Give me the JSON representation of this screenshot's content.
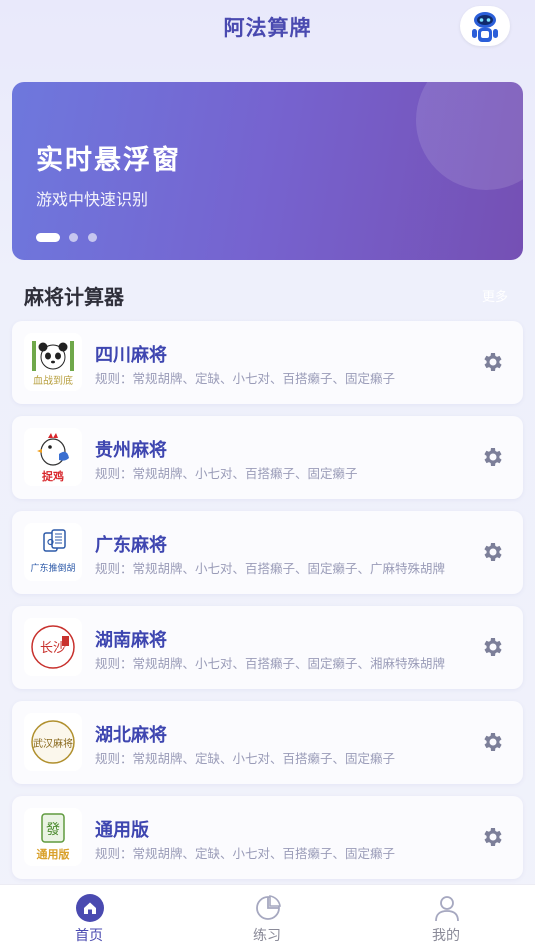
{
  "header": {
    "title": "阿法算牌",
    "avatar_icon": "robot-avatar-icon"
  },
  "banner": {
    "title": "实时悬浮窗",
    "subtitle": "游戏中快速识别",
    "active_slide": 1,
    "slide_count": 3
  },
  "section": {
    "title": "麻将计算器",
    "more_label": "更多"
  },
  "calculators": [
    {
      "name": "四川麻将",
      "rules": "规则：常规胡牌、定缺、小七对、百搭癞子、固定癞子",
      "icon": "panda-icon",
      "icon_text": "血战到底"
    },
    {
      "name": "贵州麻将",
      "rules": "规则：常规胡牌、小七对、百搭癞子、固定癞子",
      "icon": "chicken-icon",
      "icon_text": "捉鸡"
    },
    {
      "name": "广东麻将",
      "rules": "规则：常规胡牌、小七对、百搭癞子、固定癞子、广麻特殊胡牌",
      "icon": "tile-icon",
      "icon_text": "广东推倒胡"
    },
    {
      "name": "湖南麻将",
      "rules": "规则：常规胡牌、小七对、百搭癞子、固定癞子、湘麻特殊胡牌",
      "icon": "changsha-seal-icon",
      "icon_text": "长沙"
    },
    {
      "name": "湖北麻将",
      "rules": "规则：常规胡牌、定缺、小七对、百搭癞子、固定癞子",
      "icon": "wuhan-seal-icon",
      "icon_text": "武汉麻将"
    },
    {
      "name": "通用版",
      "rules": "规则：常规胡牌、定缺、小七对、百搭癞子、固定癞子",
      "icon": "fa-tile-icon",
      "icon_text": "通用版"
    }
  ],
  "bottom_nav": [
    {
      "label": "首页",
      "icon": "home-icon",
      "active": true
    },
    {
      "label": "练习",
      "icon": "practice-icon",
      "active": false
    },
    {
      "label": "我的",
      "icon": "user-icon",
      "active": false
    }
  ],
  "colors": {
    "accent": "#4a4ab0",
    "banner_start": "#6e78dd",
    "banner_end": "#7550b4",
    "card_title": "#3e46b0",
    "rules_text": "#9a9cb8",
    "gear": "#7c7f99"
  }
}
